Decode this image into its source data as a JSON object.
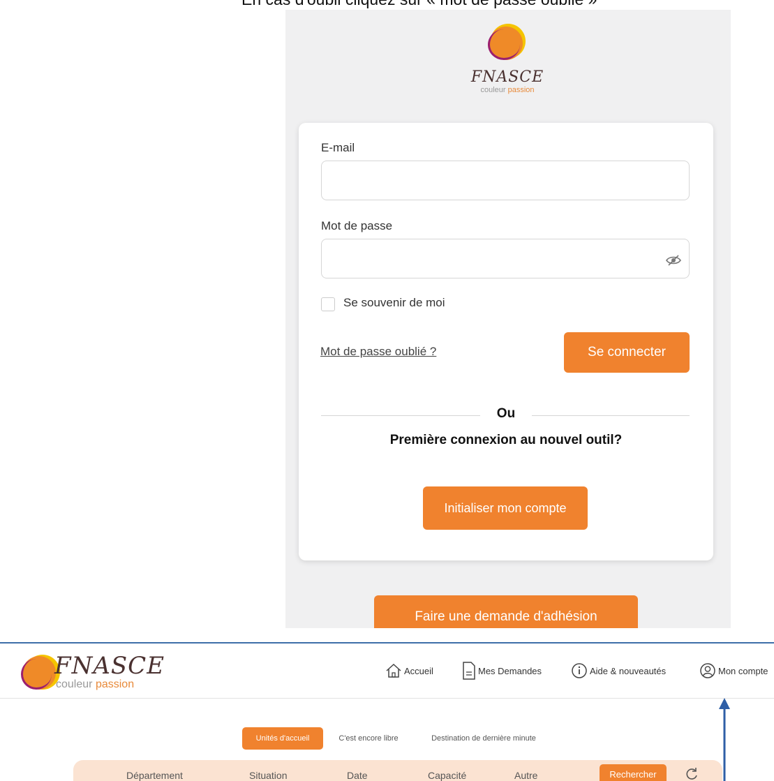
{
  "caption": "En cas d'oubli cliquez sur « mot de passe oublié »",
  "login": {
    "logo": {
      "brand": "FNASCE",
      "tagline_part1": "couleur",
      "tagline_part2": "passion"
    },
    "email_label": "E-mail",
    "email_value": "",
    "password_label": "Mot de passe",
    "password_value": "",
    "remember_label": "Se souvenir de moi",
    "forgot_link": "Mot de passe oublié ?",
    "connect_button": "Se connecter",
    "or_label": "Ou",
    "first_connection_text": "Première connexion au nouvel outil?",
    "init_button": "Initialiser mon compte",
    "membership_button": "Faire une demande d'adhésion"
  },
  "app": {
    "logo": {
      "brand": "FNASCE",
      "tagline_part1": "couleur",
      "tagline_part2": "passion"
    },
    "nav": [
      {
        "label": "Accueil",
        "icon": "home-icon"
      },
      {
        "label": "Mes Demandes",
        "icon": "document-icon"
      },
      {
        "label": "Aide & nouveautés",
        "icon": "info-icon"
      },
      {
        "label": "Mon compte",
        "icon": "user-icon"
      }
    ],
    "tabs": [
      {
        "label": "Unités d'accueil",
        "active": true
      },
      {
        "label": "C'est encore libre",
        "active": false
      },
      {
        "label": "Destination de dernière minute",
        "active": false
      }
    ],
    "filters": [
      "Département",
      "Situation",
      "Date",
      "Capacité",
      "Autre"
    ],
    "search_button": "Rechercher"
  },
  "colors": {
    "accent": "#f0822e",
    "annotation_arrow": "#2f5fa6",
    "logo_yellow": "#f5c400",
    "logo_purple": "#9b1f6e"
  }
}
